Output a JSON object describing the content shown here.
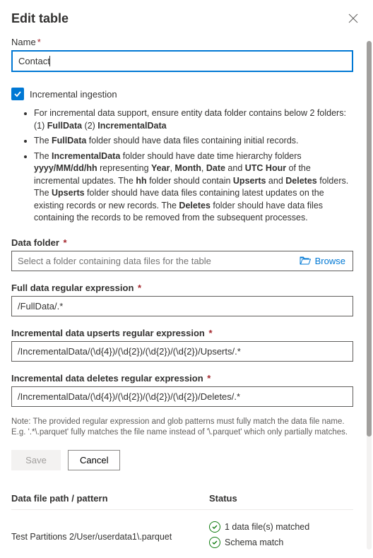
{
  "header": {
    "title": "Edit table"
  },
  "name": {
    "label": "Name",
    "value": "Contact"
  },
  "incremental": {
    "checkbox_label": "Incremental ingestion",
    "bullets": {
      "b1_pre": "For incremental data support, ensure entity data folder contains below 2 folders: (1) ",
      "b1_fd": "FullData",
      "b1_mid": " (2) ",
      "b1_id": "IncrementalData",
      "b2_pre": "The ",
      "b2_fd": "FullData",
      "b2_post": " folder should have data files containing initial records.",
      "b3_pre": "The ",
      "b3_id": "IncrementalData",
      "b3_a": " folder should have date time hierarchy folders ",
      "b3_path": "yyyy/MM/dd/hh",
      "b3_b": " representing ",
      "b3_y": "Year",
      "b3_c1": ", ",
      "b3_m": "Month",
      "b3_c2": ", ",
      "b3_d": "Date",
      "b3_c3": " and ",
      "b3_u": "UTC Hour",
      "b3_mid": " of the incremental updates. The ",
      "b3_hh": "hh",
      "b3_mid2": " folder should contain ",
      "b3_up": "Upserts",
      "b3_and": " and ",
      "b3_de": "Deletes",
      "b3_mid3": " folders. The ",
      "b3_up2": "Upserts",
      "b3_e": " folder should have data files containing latest updates on the existing records or new records. The ",
      "b3_de2": "Deletes",
      "b3_f": " folder should have data files containing the records to be removed from the subsequent processes."
    }
  },
  "data_folder": {
    "label": "Data folder",
    "placeholder": "Select a folder containing data files for the table",
    "browse_label": "Browse"
  },
  "full_regex": {
    "label": "Full data regular expression",
    "value": "/FullData/.*"
  },
  "upserts_regex": {
    "label": "Incremental data upserts regular expression",
    "value": "/IncrementalData/(\\d{4})/(\\d{2})/(\\d{2})/(\\d{2})/Upserts/.*"
  },
  "deletes_regex": {
    "label": "Incremental data deletes regular expression",
    "value": "/IncrementalData/(\\d{4})/(\\d{2})/(\\d{2})/(\\d{2})/Deletes/.*"
  },
  "note": "Note: The provided regular expression and glob patterns must fully match the data file name. E.g. '.*\\.parquet' fully matches the file name instead of '\\.parquet' which only partially matches.",
  "buttons": {
    "save": "Save",
    "cancel": "Cancel"
  },
  "table": {
    "col1": "Data file path / pattern",
    "col2": "Status",
    "row1_path": "Test Partitions 2/User/userdata1\\.parquet",
    "row1_status1": "1 data file(s) matched",
    "row1_status2": "Schema match"
  }
}
